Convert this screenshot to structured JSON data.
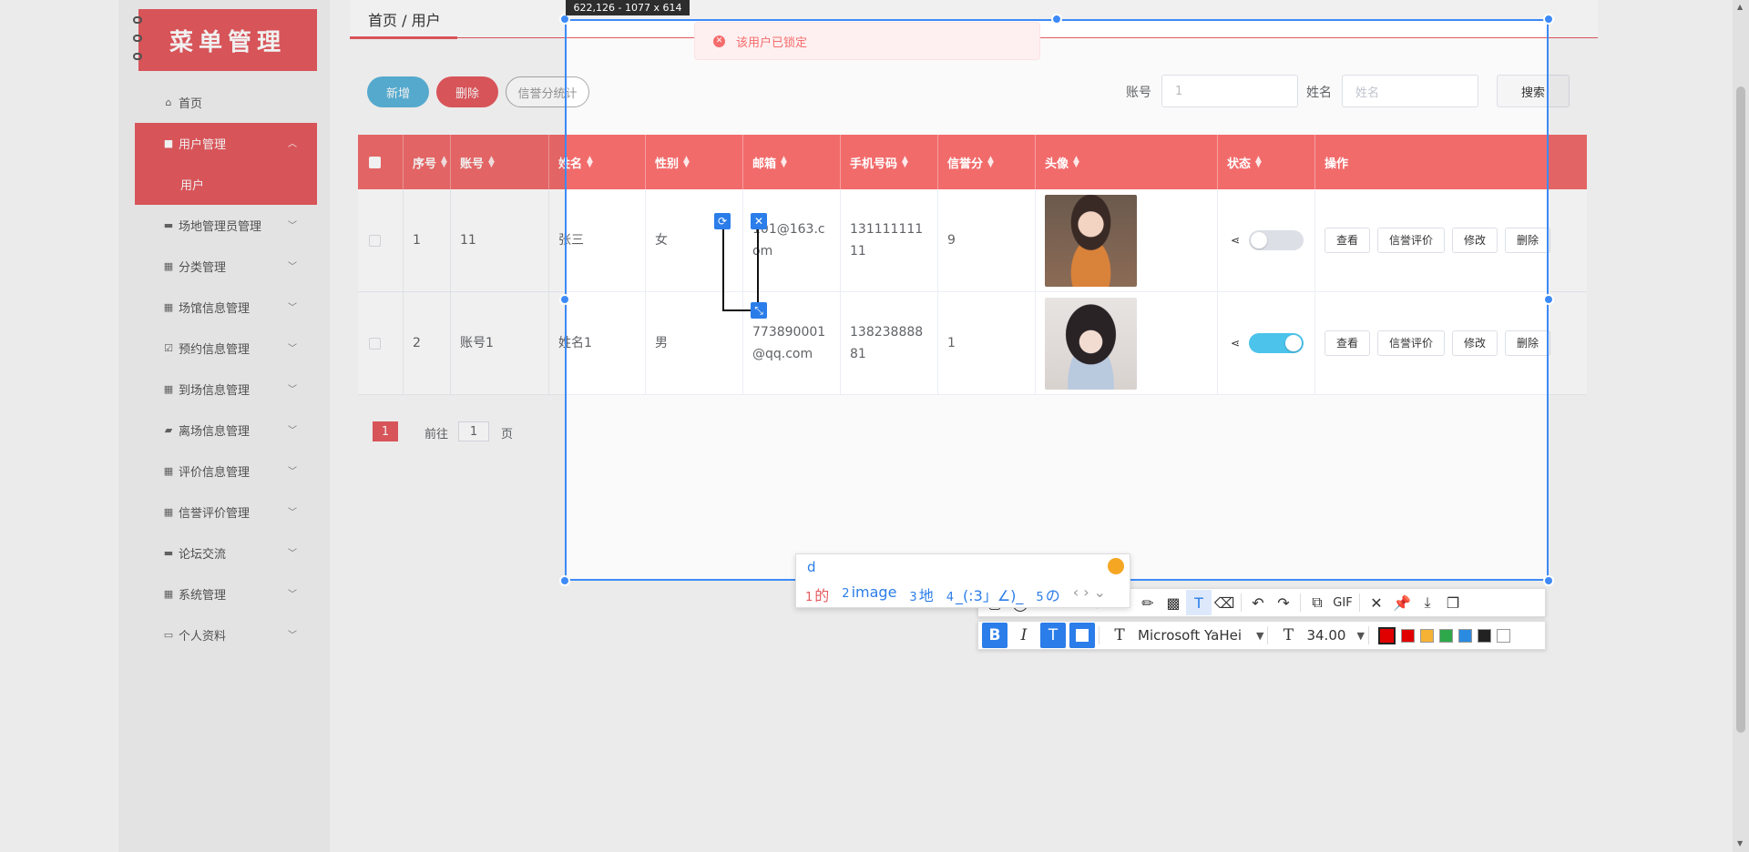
{
  "app": {
    "logo_text": "菜单管理"
  },
  "sidebar": {
    "items": [
      {
        "label": "首页",
        "icon": "home-icon",
        "glyph": "⌂"
      },
      {
        "label": "用户管理",
        "icon": "user-manage-icon",
        "glyph": "■",
        "expanded": true
      },
      {
        "label": "场地管理员管理",
        "icon": "ticket-icon",
        "glyph": "▬"
      },
      {
        "label": "分类管理",
        "icon": "grid-icon",
        "glyph": "▦"
      },
      {
        "label": "场馆信息管理",
        "icon": "grid-icon",
        "glyph": "▦"
      },
      {
        "label": "预约信息管理",
        "icon": "checkbox-icon",
        "glyph": "☑"
      },
      {
        "label": "到场信息管理",
        "icon": "grid-icon",
        "glyph": "▦"
      },
      {
        "label": "离场信息管理",
        "icon": "briefcase-icon",
        "glyph": "▰"
      },
      {
        "label": "评价信息管理",
        "icon": "grid-icon",
        "glyph": "▦"
      },
      {
        "label": "信誉评价管理",
        "icon": "grid-icon",
        "glyph": "▦"
      },
      {
        "label": "论坛交流",
        "icon": "chat-icon",
        "glyph": "▬"
      },
      {
        "label": "系统管理",
        "icon": "grid-icon",
        "glyph": "▦"
      },
      {
        "label": "个人资料",
        "icon": "profile-icon",
        "glyph": "▭"
      }
    ],
    "submenu": {
      "label": "用户"
    }
  },
  "breadcrumb": {
    "text": "首页 / 用户"
  },
  "toolbar": {
    "add_label": "新增",
    "delete_label": "删除",
    "stats_label": "信誉分统计",
    "account_label": "账号",
    "account_value": "1",
    "name_label": "姓名",
    "name_placeholder": "姓名",
    "search_label": "搜索"
  },
  "table": {
    "headers": [
      "序号",
      "账号",
      "姓名",
      "性别",
      "邮箱",
      "手机号码",
      "信誉分",
      "头像",
      "状态",
      "操作"
    ],
    "rows": [
      {
        "index": "1",
        "account": "11",
        "name": "张三",
        "gender": "女",
        "email": "101@163.com",
        "phone": "13111111111",
        "score": "9",
        "status_on": false
      },
      {
        "index": "2",
        "account": "账号1",
        "name": "姓名1",
        "gender": "男",
        "email": "773890001@qq.com",
        "phone": "13823888881",
        "score": "1",
        "status_on": true
      }
    ],
    "actions": [
      "查看",
      "信誉评价",
      "修改",
      "删除"
    ]
  },
  "pagination": {
    "current": "1",
    "goto_label": "前往",
    "goto_value": "1",
    "page_label": "页"
  },
  "toast": {
    "message": "该用户已锁定"
  },
  "screenshot_tool": {
    "dimension_label": "622,126 - 1077 x 614",
    "font_name": "Microsoft YaHei",
    "font_size": "34.00",
    "gif_label": "GIF",
    "colors": [
      "#e00000",
      "#f5b335",
      "#2ea84a",
      "#2b8be0",
      "#222222",
      "#ffffff"
    ],
    "active_color": "#e00000"
  },
  "ime": {
    "input": "d",
    "candidates": [
      "的",
      "image",
      "地",
      "_(:3」∠)_",
      "の"
    ]
  },
  "colors": {
    "primary": "#e55a5f",
    "header_bg": "#f26b6b",
    "add_btn": "#5bb4da",
    "switch_on": "#4cc3eb",
    "selection": "#3d8af7"
  }
}
